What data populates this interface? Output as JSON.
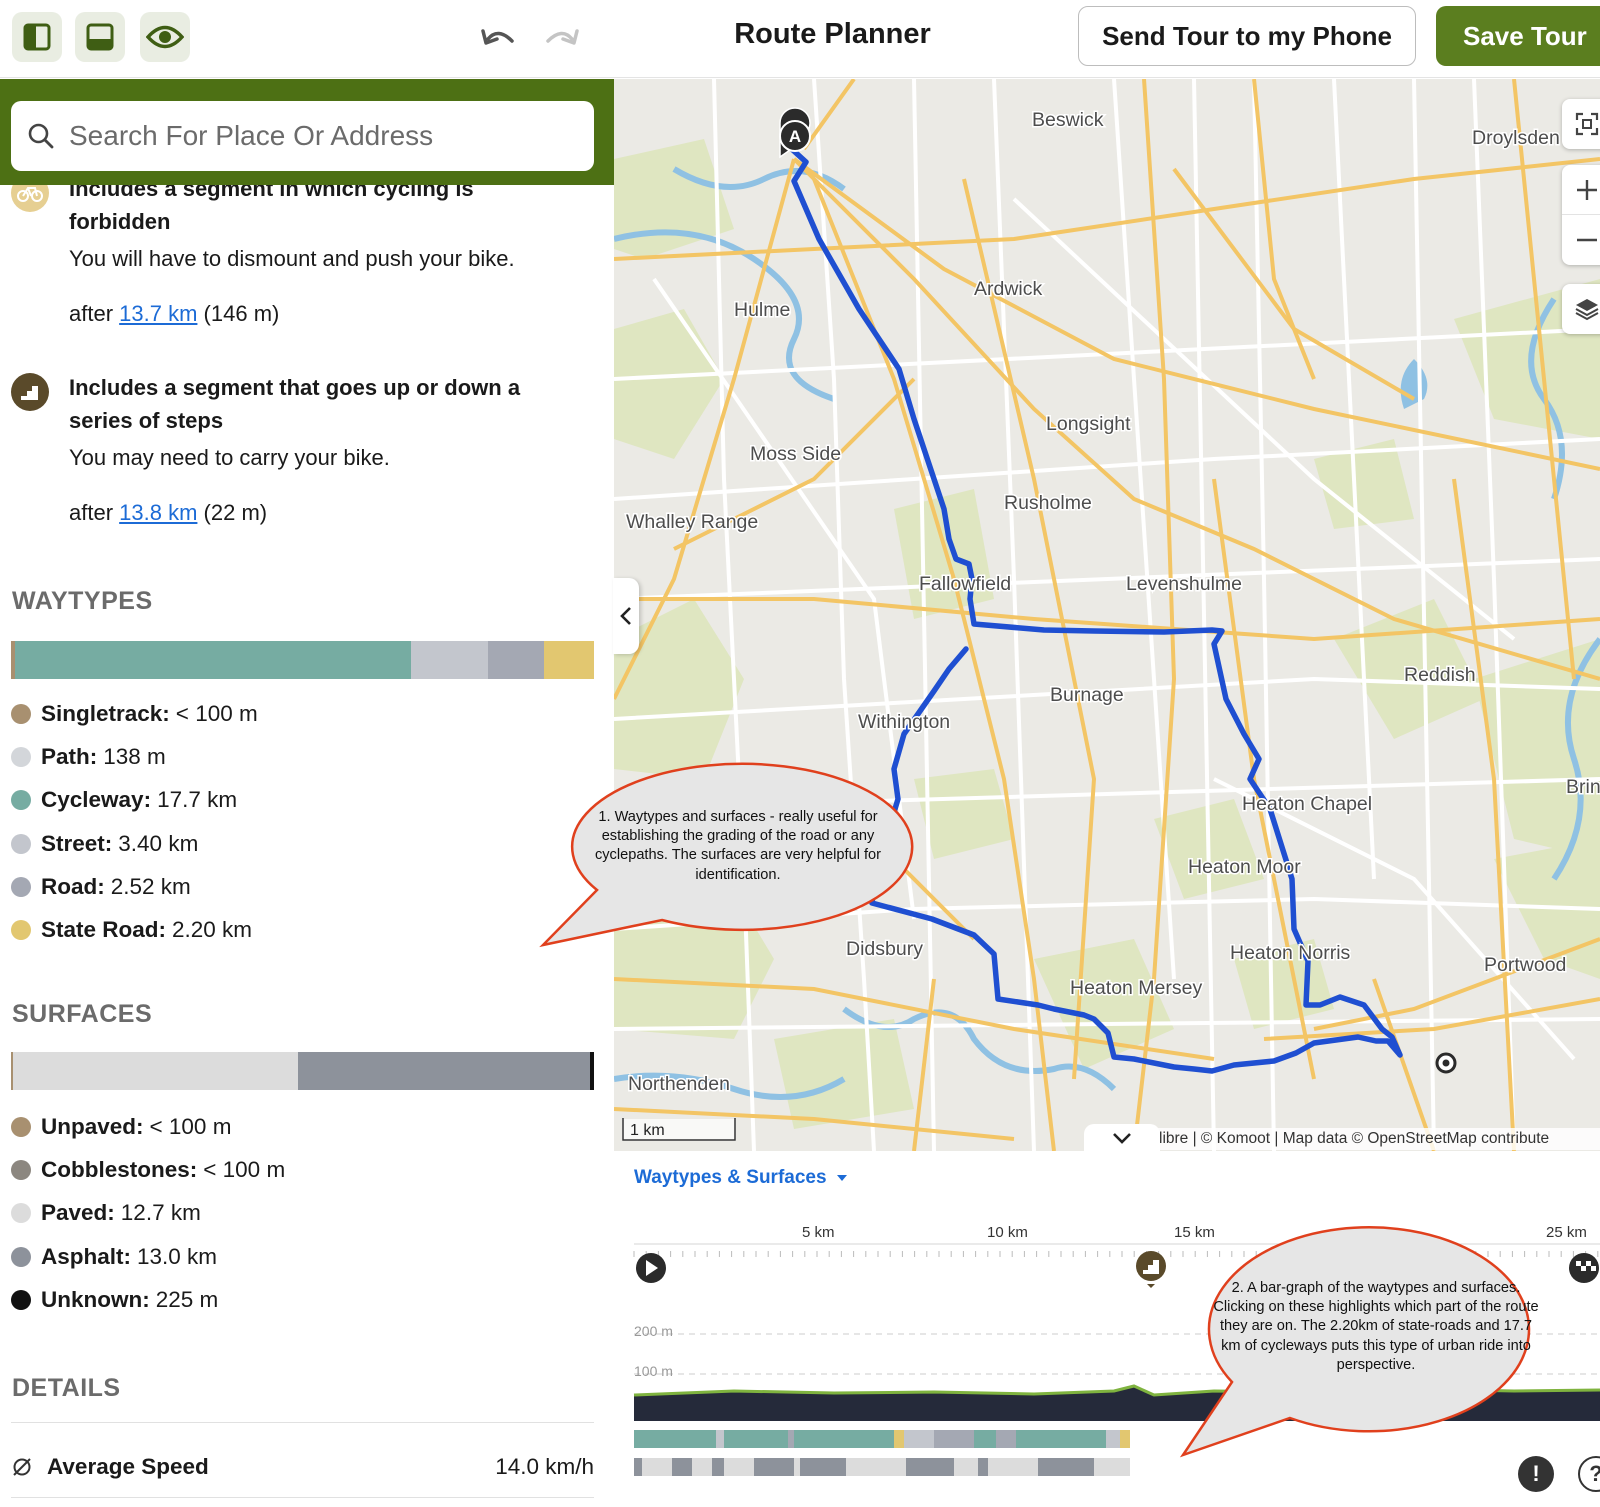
{
  "topbar": {
    "title": "Route Planner",
    "send_button": "Send Tour to my Phone",
    "save_button": "Save Tour",
    "icons": [
      "sidebar-left-icon",
      "panel-bottom-icon",
      "eye-icon",
      "undo-icon",
      "redo-icon"
    ]
  },
  "search": {
    "placeholder": "Search For Place Or Address"
  },
  "warnings": [
    {
      "icon": "no-cycling-icon",
      "title": "Includes a segment in which cycling is forbidden",
      "text": "You will have to dismount and push your bike.",
      "after_prefix": "after",
      "after_link": "13.7 km",
      "after_suffix": "(146 m)"
    },
    {
      "icon": "steps-icon",
      "title": "Includes a segment that goes up or down a series of steps",
      "text": "You may need to carry your bike.",
      "after_prefix": "after",
      "after_link": "13.8 km",
      "after_suffix": "(22 m)"
    }
  ],
  "waytypes": {
    "heading": "WAYTYPES",
    "items": [
      {
        "label": "Singletrack:",
        "value": "< 100 m",
        "color": "#a89070"
      },
      {
        "label": "Path:",
        "value": "138 m",
        "color": "#d3d6da"
      },
      {
        "label": "Cycleway:",
        "value": "17.7 km",
        "color": "#76aca2"
      },
      {
        "label": "Street:",
        "value": "3.40 km",
        "color": "#c3c6cd"
      },
      {
        "label": "Road:",
        "value": "2.52 km",
        "color": "#a4a8b3"
      },
      {
        "label": "State Road:",
        "value": "2.20 km",
        "color": "#e2c770"
      }
    ]
  },
  "surfaces": {
    "heading": "SURFACES",
    "items": [
      {
        "label": "Unpaved:",
        "value": "< 100 m",
        "color": "#a89070"
      },
      {
        "label": "Cobblestones:",
        "value": "< 100 m",
        "color": "#8c8780"
      },
      {
        "label": "Paved:",
        "value": "12.7 km",
        "color": "#dcdcdc"
      },
      {
        "label": "Asphalt:",
        "value": "13.0 km",
        "color": "#8d929b"
      },
      {
        "label": "Unknown:",
        "value": "225 m",
        "color": "#111111"
      }
    ]
  },
  "details": {
    "heading": "DETAILS",
    "avg_speed_label": "Average Speed",
    "avg_speed_value": "14.0 km/h"
  },
  "map": {
    "places": [
      "Beswick",
      "Droylsden",
      "Ardwick",
      "Hulme",
      "Longsight",
      "Moss Side",
      "Rusholme",
      "Whalley Range",
      "Fallowfield",
      "Levenshulme",
      "Reddish",
      "Burnage",
      "Withington",
      "Brin",
      "Heaton Chapel",
      "Heaton Moor",
      "Didsbury",
      "Heaton Norris",
      "Portwood",
      "Heaton Mersey",
      "Northenden"
    ],
    "start_marker": "A",
    "scale": "1 km",
    "attribution": "libre | © Komoot | Map data © OpenStreetMap contribute"
  },
  "profile": {
    "dropdown": "Waytypes & Surfaces",
    "km_ticks": [
      "5 km",
      "10 km",
      "15 km",
      "25 km"
    ],
    "alt_ticks": [
      "200 m",
      "100 m"
    ]
  },
  "callouts": [
    {
      "text": "1. Waytypes and surfaces - really useful for establishing the grading of the road or any cyclepaths. The surfaces are very helpful for identification."
    },
    {
      "text": "2. A bar-graph of the waytypes and surfaces. Clicking on these highlights which part of the route they are on. The 2.20km of state-roads and 17.7 km of cycleways puts this type of urban ride into perspective."
    }
  ],
  "colors": {
    "brand_green": "#5b7e1f",
    "route_blue": "#1f4fd1",
    "callout_red": "#e0401d"
  }
}
